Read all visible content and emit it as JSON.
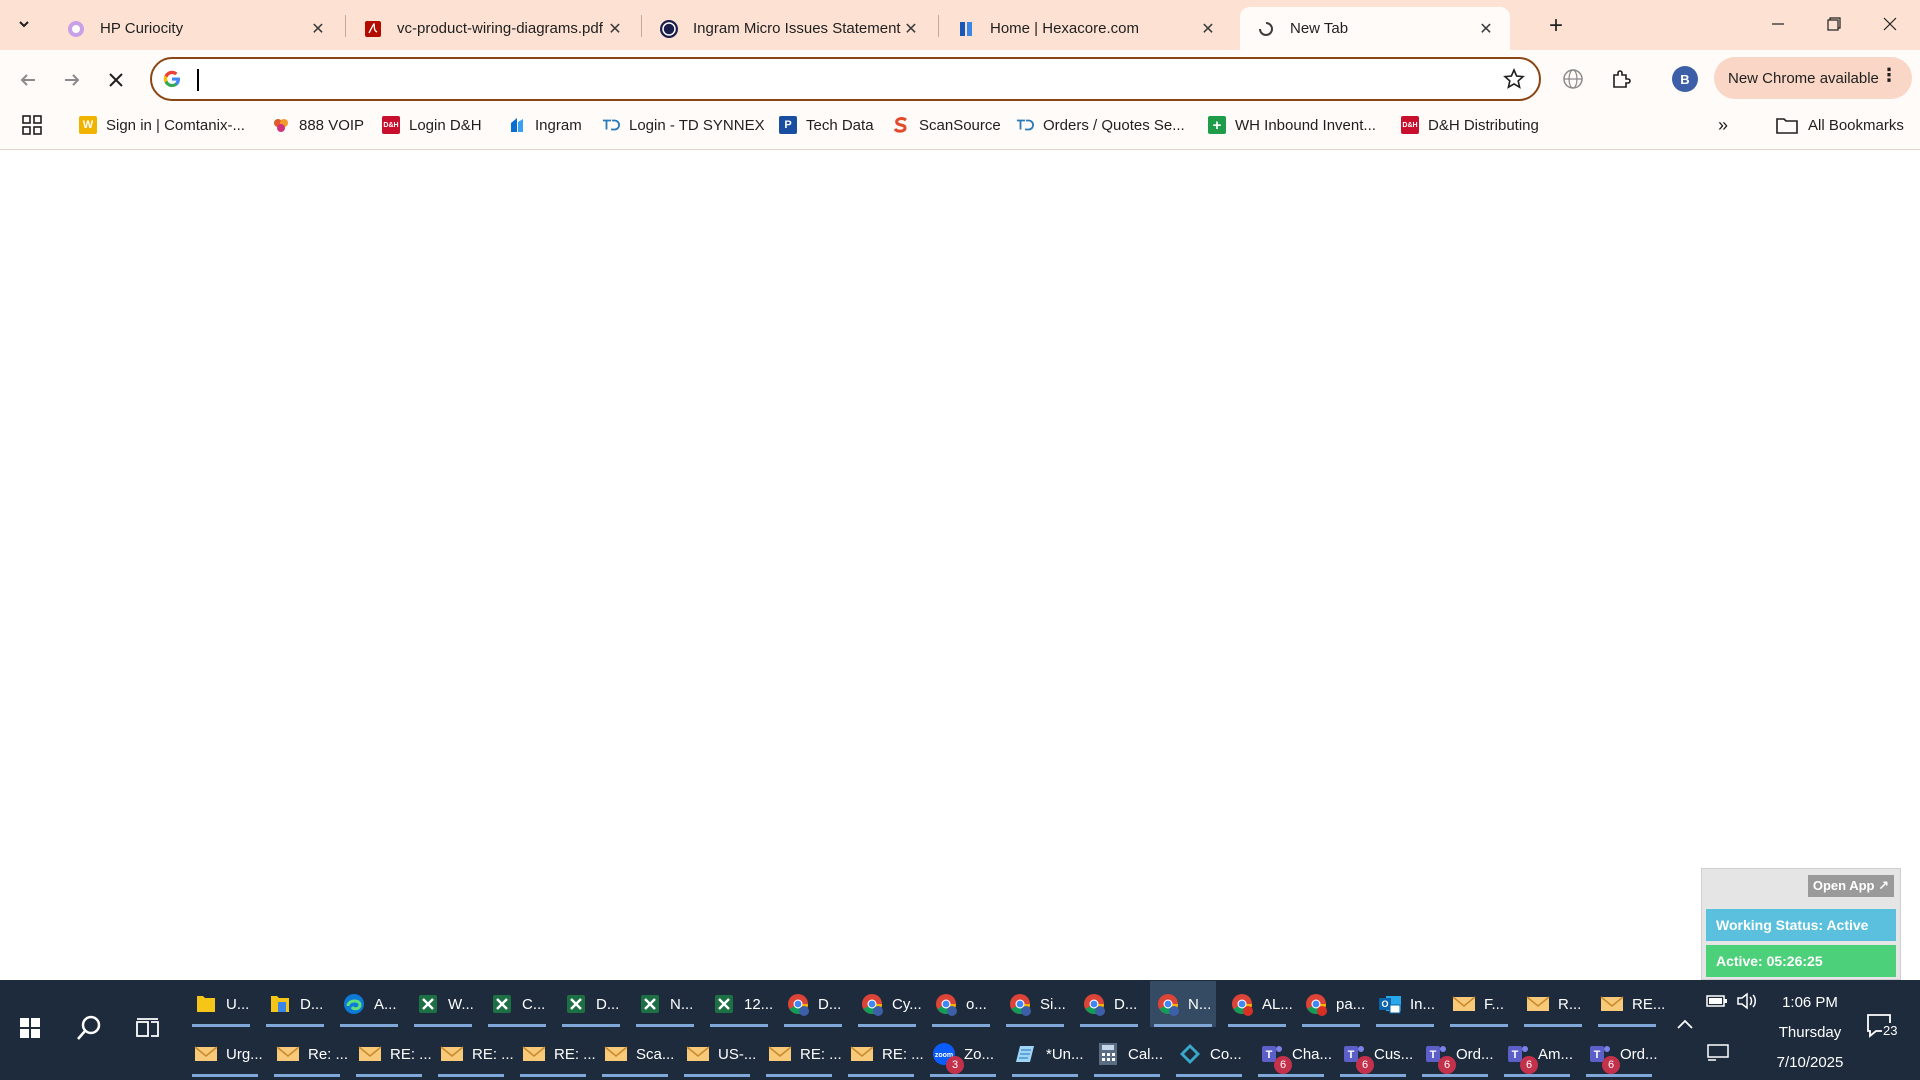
{
  "browser": {
    "tabs": [
      {
        "title": "HP Curiocity",
        "icon": "hp-icon",
        "active": false
      },
      {
        "title": "vc-product-wiring-diagrams.pdf",
        "icon": "pdf-icon",
        "active": false
      },
      {
        "title": "Ingram Micro Issues Statement",
        "icon": "ingram-icon",
        "active": false
      },
      {
        "title": "Home | Hexacore.com",
        "icon": "hexacore-icon",
        "active": false
      },
      {
        "title": "New Tab",
        "icon": "loading-icon",
        "active": true
      }
    ],
    "omnibox": {
      "value": "",
      "placeholder": ""
    },
    "chrome_available_label": "New Chrome available",
    "profile_initial": "B"
  },
  "bookmarks": {
    "items": [
      {
        "label": "Sign in | Comtanix-...",
        "icon": "W",
        "color": "#f0b400"
      },
      {
        "label": "888 VOIP",
        "icon": "people",
        "color": "#e05a2b"
      },
      {
        "label": "Login D&H",
        "icon": "D&H",
        "color": "#c8102e"
      },
      {
        "label": "Ingram",
        "icon": "ingram",
        "color": "#0b6ed1"
      },
      {
        "label": "Login - TD SYNNEX",
        "icon": "TD",
        "color": "#2a7ab8"
      },
      {
        "label": "Tech Data",
        "icon": "P",
        "color": "#1b4ea0"
      },
      {
        "label": "ScanSource",
        "icon": "S",
        "color": "#e24a2b"
      },
      {
        "label": "Orders / Quotes Se...",
        "icon": "TD",
        "color": "#2a7ab8"
      },
      {
        "label": "WH Inbound Invent...",
        "icon": "+",
        "color": "#1e9c4a"
      },
      {
        "label": "D&H Distributing",
        "icon": "D&H",
        "color": "#c8102e"
      }
    ],
    "all_bookmarks_label": "All Bookmarks"
  },
  "widget": {
    "open_app_label": "Open App ↗",
    "status_label": "Working Status: Active",
    "active_label": "Active: 05:26:25"
  },
  "taskbar": {
    "row1": [
      {
        "label": "U...",
        "icon": "folder"
      },
      {
        "label": "D...",
        "icon": "folder-doc"
      },
      {
        "label": "A...",
        "icon": "edge"
      },
      {
        "label": "W...",
        "icon": "excel"
      },
      {
        "label": "C...",
        "icon": "excel"
      },
      {
        "label": "D...",
        "icon": "excel"
      },
      {
        "label": "N...",
        "icon": "excel"
      },
      {
        "label": "12...",
        "icon": "excel"
      },
      {
        "label": "D...",
        "icon": "chrome"
      },
      {
        "label": "Cy...",
        "icon": "chrome"
      },
      {
        "label": "o...",
        "icon": "chrome"
      },
      {
        "label": "Si...",
        "icon": "chrome"
      },
      {
        "label": "D...",
        "icon": "chrome"
      },
      {
        "label": "N...",
        "icon": "chrome"
      },
      {
        "label": "AL...",
        "icon": "chrome-red"
      },
      {
        "label": "pa...",
        "icon": "chrome-red"
      },
      {
        "label": "In...",
        "icon": "outlook"
      },
      {
        "label": "F...",
        "icon": "mail"
      },
      {
        "label": "R...",
        "icon": "mail"
      },
      {
        "label": "RE...",
        "icon": "mail"
      }
    ],
    "row2": [
      {
        "label": "Urg...",
        "icon": "mail"
      },
      {
        "label": "Re: ...",
        "icon": "mail"
      },
      {
        "label": "RE: ...",
        "icon": "mail"
      },
      {
        "label": "RE: ...",
        "icon": "mail"
      },
      {
        "label": "RE: ...",
        "icon": "mail"
      },
      {
        "label": "Sca...",
        "icon": "mail"
      },
      {
        "label": "US-...",
        "icon": "mail"
      },
      {
        "label": "RE: ...",
        "icon": "mail"
      },
      {
        "label": "RE: ...",
        "icon": "mail"
      },
      {
        "label": "Zo...",
        "icon": "zoom",
        "badge": "3"
      },
      {
        "label": "*Un...",
        "icon": "notepad"
      },
      {
        "label": "Cal...",
        "icon": "calculator"
      },
      {
        "label": "Co...",
        "icon": "copilot"
      },
      {
        "label": "Cha...",
        "icon": "teams",
        "badge": "6"
      },
      {
        "label": "Cus...",
        "icon": "teams",
        "badge": "6"
      },
      {
        "label": "Ord...",
        "icon": "teams",
        "badge": "6"
      },
      {
        "label": "Am...",
        "icon": "teams",
        "badge": "6"
      },
      {
        "label": "Ord...",
        "icon": "teams",
        "badge": "6"
      }
    ],
    "time": "1:06 PM",
    "day": "Thursday",
    "date": "7/10/2025",
    "notification_count": "23"
  }
}
